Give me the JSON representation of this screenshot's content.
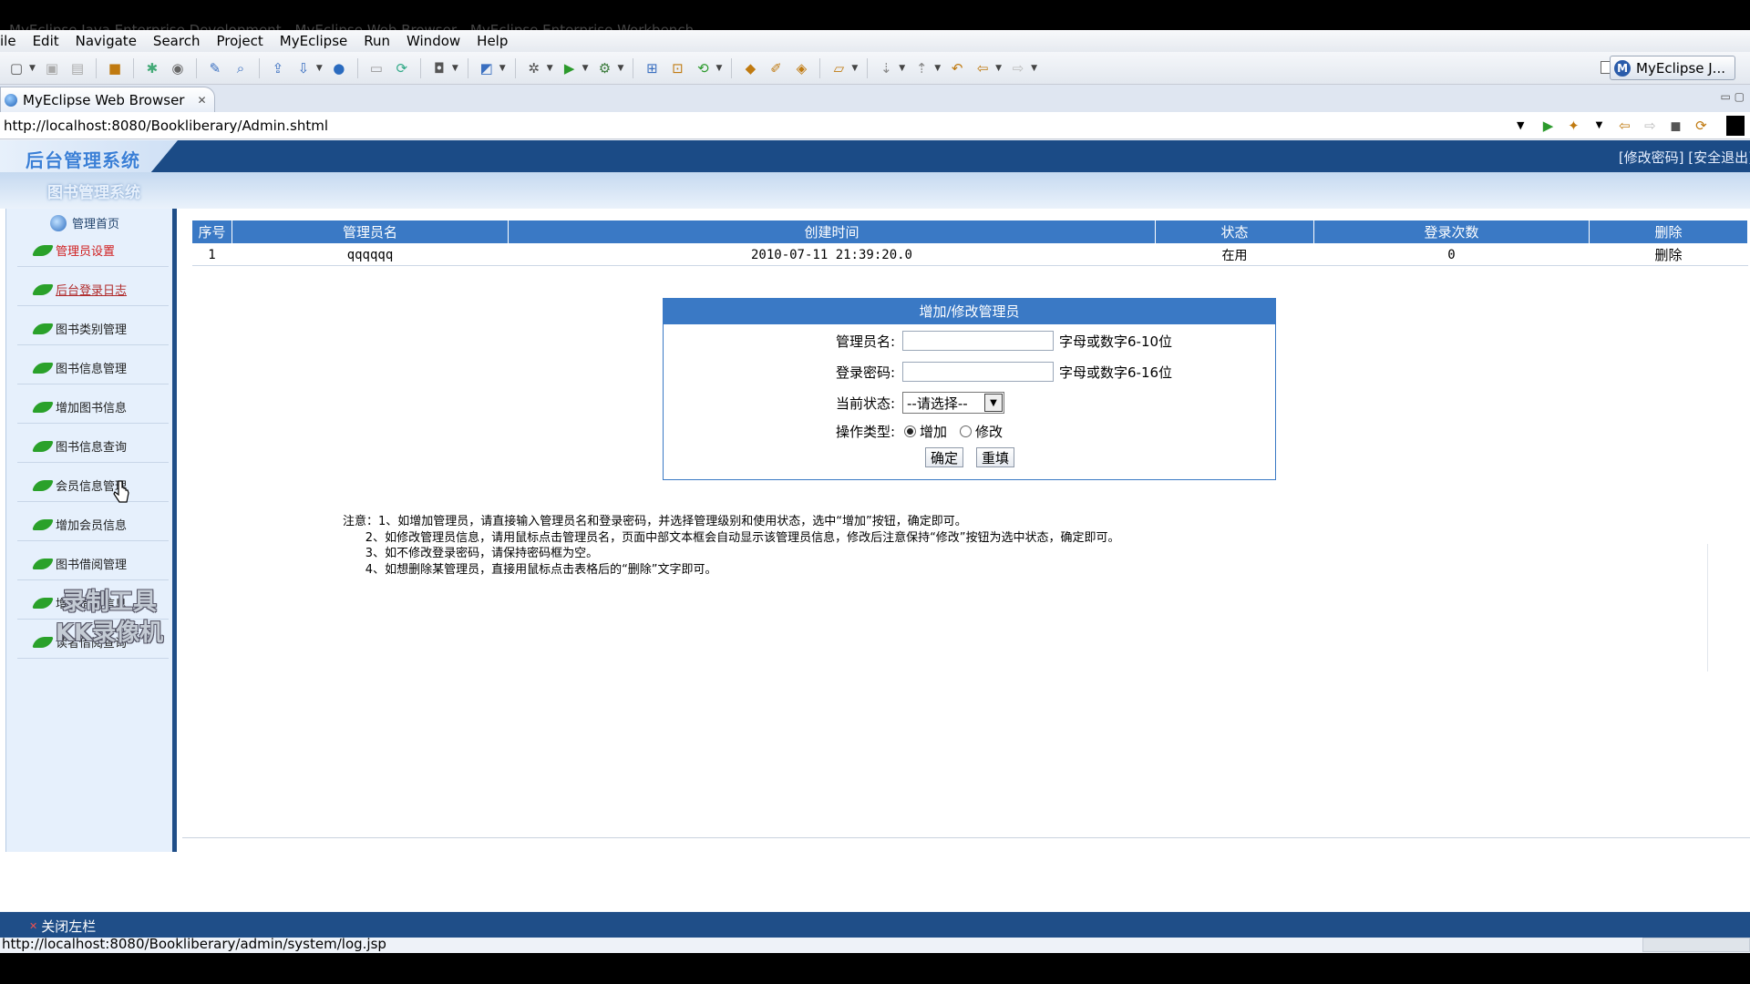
{
  "window": {
    "title": "MyEclipse Java Enterprise Development - MyEclipse Web Browser - MyEclipse Enterprise Workbench"
  },
  "menubar": {
    "items": [
      "ile",
      "Edit",
      "Navigate",
      "Search",
      "Project",
      "MyEclipse",
      "Run",
      "Window",
      "Help"
    ]
  },
  "perspective": {
    "label": "MyEclipse J...",
    "icon": "myeclipse-perspective-icon"
  },
  "editor": {
    "tab_label": "MyEclipse Web Browser",
    "url": "http://localhost:8080/Bookliberary/Admin.shtml"
  },
  "site": {
    "logo": "后台管理系统",
    "header_links": "[修改密码] [安全退出]",
    "system_name": "图书管理系统",
    "home_label": "管理首页",
    "sidebar": {
      "items": [
        {
          "label": "管理员设置"
        },
        {
          "label": "后台登录日志"
        },
        {
          "label": "图书类别管理"
        },
        {
          "label": "图书信息管理"
        },
        {
          "label": "增加图书信息"
        },
        {
          "label": "图书信息查询"
        },
        {
          "label": "会员信息管理"
        },
        {
          "label": "增加会员信息"
        },
        {
          "label": "图书借阅管理"
        },
        {
          "label": "增加借阅信息"
        },
        {
          "label": "读者借阅查询"
        }
      ]
    },
    "watermark": [
      "录制工具",
      "KK录像机"
    ],
    "close_left": "关闭左栏"
  },
  "admin_table": {
    "headers": [
      "序号",
      "管理员名",
      "创建时间",
      "状态",
      "登录次数",
      "删除"
    ],
    "rows": [
      {
        "index": "1",
        "name": "qqqqqq",
        "created": "2010-07-11 21:39:20.0",
        "status": "在用",
        "logins": "0",
        "delete": "删除"
      }
    ]
  },
  "form": {
    "title": "增加/修改管理员",
    "name_label": "管理员名:",
    "name_hint": "字母或数字6-10位",
    "password_label": "登录密码:",
    "password_hint": "字母或数字6-16位",
    "state_label": "当前状态:",
    "state_selected": "--请选择--",
    "op_label": "操作类型:",
    "op_add": "增加",
    "op_modify": "修改",
    "submit": "确定",
    "reset": "重填"
  },
  "notes": [
    "注意：1、如增加管理员，请直接输入管理员名和登录密码，并选择管理级别和使用状态，选中“增加”按钮，确定即可。",
    "      2、如修改管理员信息，请用鼠标点击管理员名，页面中部文本框会自动显示该管理员信息，修改后注意保持“修改”按钮为选中状态，确定即可。",
    "      3、如不修改登录密码，请保持密码框为空。",
    "      4、如想删除某管理员，直接用鼠标点击表格后的“删除”文字即可。"
  ],
  "status": {
    "url": "http://localhost:8080/Bookliberary/admin/system/log.jsp"
  }
}
